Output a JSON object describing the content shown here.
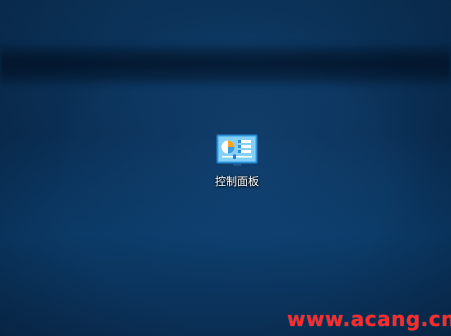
{
  "desktop": {
    "icons": [
      {
        "label": "控制面板",
        "icon": "control-panel-icon"
      }
    ]
  },
  "watermark": {
    "text": "www.acang.cn",
    "color": "#ff2a2a"
  },
  "colors": {
    "wallpaper_base": "#0b2f52",
    "label_text": "#ffffff"
  }
}
